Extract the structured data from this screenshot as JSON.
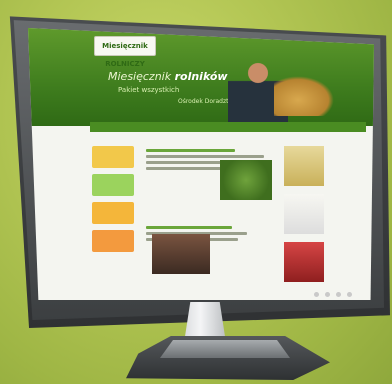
{
  "website": {
    "logo_text": "Miesięcznik ROLNICZY",
    "tagline_part1": "Miesięcznik ",
    "tagline_bold": "rolników",
    "tagline_line2": "Pakiet wszystkich",
    "tagline_line3": "Ośrodek Doradztwa"
  },
  "colors": {
    "background": "#b3c654",
    "header_green": "#3f7d1e",
    "monitor_frame": "#2f3133"
  }
}
